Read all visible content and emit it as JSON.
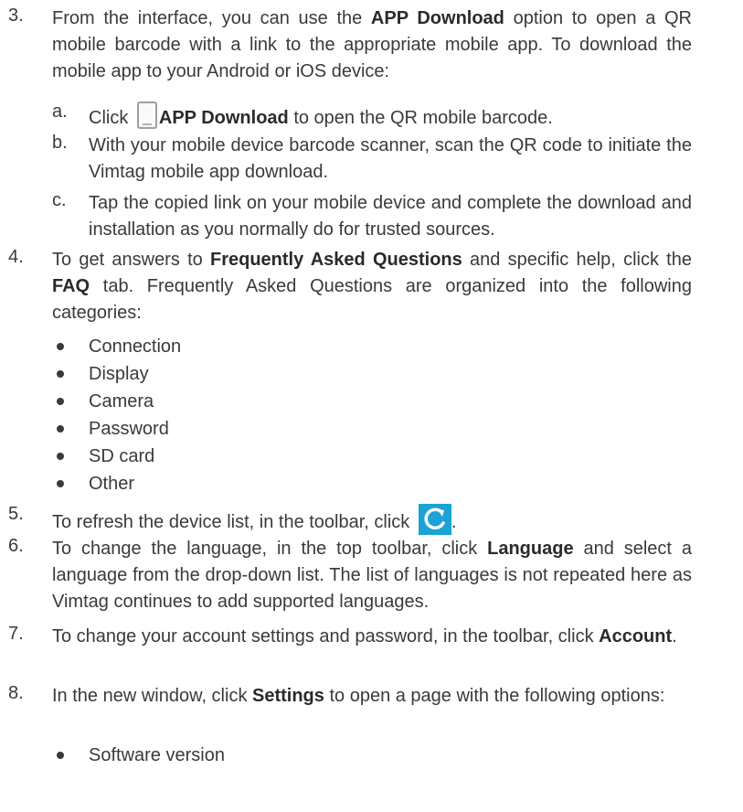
{
  "steps": [
    {
      "num": "3.",
      "p1": "From the interface, you can use the ",
      "b1": "APP Download",
      "p2": " option to open a QR mobile barcode with a link to the appropriate mobile app. To download the mobile app to your Android or iOS device:",
      "subs": [
        {
          "label": "a.",
          "pre": "Click ",
          "icon": "phone-icon",
          "bold": "APP Download",
          "post": " to open the QR mobile barcode."
        },
        {
          "label": "b.",
          "text": "With your mobile device barcode scanner, scan the QR code to initiate the Vimtag mobile app download."
        },
        {
          "label": "c.",
          "text": "Tap the copied link on your mobile device and complete the download and installation as you normally do for trusted sources."
        }
      ]
    },
    {
      "num": "4.",
      "p1": "To get answers to ",
      "b1": "Frequently Asked Questions",
      "p2": " and specific help, click the ",
      "b2": "FAQ",
      "p3": " tab. Frequently Asked Questions are organized into the following categories:",
      "bullets": [
        "Connection",
        "Display",
        "Camera",
        "Password",
        "SD card",
        "Other"
      ]
    },
    {
      "num": "5.",
      "p1": "To refresh the device list, in the toolbar, click ",
      "icon": "refresh-icon",
      "p2": "."
    },
    {
      "num": "6.",
      "p1": "To change the language, in the top toolbar, click ",
      "b1": "Language",
      "p2": " and select a language from the drop-down list. The list of languages is not repeated here as Vimtag continues to add supported languages."
    },
    {
      "num": "7.",
      "p1": "To change your account settings and password, in the toolbar, click ",
      "b1": "Account",
      "p2": "."
    },
    {
      "num": "8.",
      "p1": "In the new window, click ",
      "b1": "Settings",
      "p2": " to open a page with the following options:",
      "bullets": [
        "Software version"
      ]
    }
  ],
  "colors": {
    "text": "#3a3a3a",
    "refresh_icon_bg": "#1aa3d4"
  }
}
